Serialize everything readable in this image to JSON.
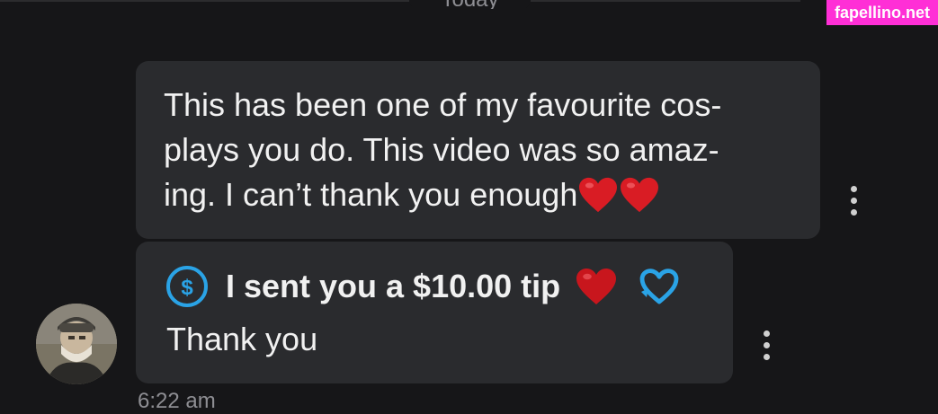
{
  "header": {
    "date_label": "Today"
  },
  "watermark": {
    "text": "fapellino.net"
  },
  "messages": [
    {
      "text": "This has been one of my favourite cos-plays you do. This video was so amaz-ing. I can’t thank you enough",
      "lines": [
        "This has been one of my favourite cos-",
        "plays you do. This video was so amaz-",
        "ing. I can’t thank you enough"
      ],
      "emoji": [
        "red-heart",
        "red-heart"
      ]
    },
    {
      "tip_icon": "dollar-circle-icon",
      "tip_text": "I sent you a $10.00 tip",
      "tip_emoji": [
        "red-heart",
        "blue-heart-outline"
      ],
      "body": "Thank you"
    }
  ],
  "timestamp": "6:22 am",
  "colors": {
    "background": "#161618",
    "bubble": "#2a2b2e",
    "accent_blue": "#2aa3e6",
    "heart_red": "#d91c24",
    "watermark_pink": "#ff2fd6"
  }
}
